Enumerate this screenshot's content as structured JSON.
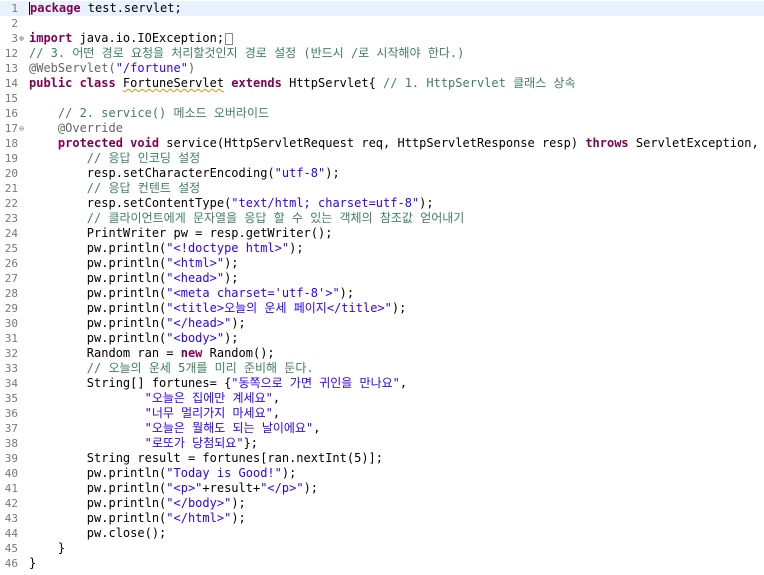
{
  "editor": {
    "language": "java",
    "current_line": 1,
    "fold_icons": {
      "3": "fold-expand-icon",
      "17": "fold-collapse-icon"
    },
    "colors": {
      "keyword": "#7f0055",
      "string": "#2a00ff",
      "comment": "#3f7f5f",
      "annotation": "#646464",
      "line_number": "#787878",
      "current_line_bg": "#e8f2fe"
    }
  },
  "lines": [
    {
      "num": "1",
      "segments": [
        {
          "t": "kw",
          "v": "package"
        },
        {
          "t": "n",
          "v": " test.servlet;"
        }
      ]
    },
    {
      "num": "2",
      "segments": []
    },
    {
      "num": "3",
      "fold": "expand",
      "segments": [
        {
          "t": "kw",
          "v": "import"
        },
        {
          "t": "n",
          "v": " java.io.IOException;"
        }
      ]
    },
    {
      "num": "12",
      "segments": [
        {
          "t": "cm",
          "v": "// 3. 어떤 경로 요청을 처리할것인지 경로 설정 (반드시 /로 시작해야 한다.)"
        }
      ]
    },
    {
      "num": "13",
      "segments": [
        {
          "t": "an",
          "v": "@WebServlet("
        },
        {
          "t": "str",
          "v": "\"/fortune\""
        },
        {
          "t": "an",
          "v": ")"
        }
      ]
    },
    {
      "num": "14",
      "segments": [
        {
          "t": "kw",
          "v": "public class "
        },
        {
          "t": "warn",
          "v": "FortuneServlet"
        },
        {
          "t": "kw",
          "v": " extends "
        },
        {
          "t": "n",
          "v": "HttpServlet{ "
        },
        {
          "t": "cm",
          "v": "// 1. HttpServlet 클래스 상속"
        }
      ]
    },
    {
      "num": "15",
      "segments": []
    },
    {
      "num": "16",
      "segments": [
        {
          "t": "cm",
          "v": "    // 2. service() 메소드 오버라이드"
        }
      ]
    },
    {
      "num": "17",
      "fold": "collapse",
      "segments": [
        {
          "t": "an",
          "v": "    @Override"
        }
      ]
    },
    {
      "num": "18",
      "segments": [
        {
          "t": "kw",
          "v": "    protected void "
        },
        {
          "t": "n",
          "v": "service(HttpServletRequest req, HttpServletResponse resp) "
        },
        {
          "t": "kw",
          "v": "throws "
        },
        {
          "t": "n",
          "v": "ServletException, IOE"
        }
      ]
    },
    {
      "num": "19",
      "segments": [
        {
          "t": "cm",
          "v": "        // 응답 인코딩 설정"
        }
      ]
    },
    {
      "num": "20",
      "segments": [
        {
          "t": "n",
          "v": "        resp.setCharacterEncoding("
        },
        {
          "t": "str",
          "v": "\"utf-8\""
        },
        {
          "t": "n",
          "v": ");"
        }
      ]
    },
    {
      "num": "21",
      "segments": [
        {
          "t": "cm",
          "v": "        // 응답 컨텐트 설정"
        }
      ]
    },
    {
      "num": "22",
      "segments": [
        {
          "t": "n",
          "v": "        resp.setContentType("
        },
        {
          "t": "str",
          "v": "\"text/html; charset=utf-8\""
        },
        {
          "t": "n",
          "v": ");"
        }
      ]
    },
    {
      "num": "23",
      "segments": [
        {
          "t": "cm",
          "v": "        // 클라이언트에게 문자열을 응답 할 수 있는 객체의 참조값 얻어내기"
        }
      ]
    },
    {
      "num": "24",
      "segments": [
        {
          "t": "n",
          "v": "        PrintWriter pw = resp.getWriter();"
        }
      ]
    },
    {
      "num": "25",
      "segments": [
        {
          "t": "n",
          "v": "        pw.println("
        },
        {
          "t": "str",
          "v": "\"<!doctype html>\""
        },
        {
          "t": "n",
          "v": ");"
        }
      ]
    },
    {
      "num": "26",
      "segments": [
        {
          "t": "n",
          "v": "        pw.println("
        },
        {
          "t": "str",
          "v": "\"<html>\""
        },
        {
          "t": "n",
          "v": ");"
        }
      ]
    },
    {
      "num": "27",
      "segments": [
        {
          "t": "n",
          "v": "        pw.println("
        },
        {
          "t": "str",
          "v": "\"<head>\""
        },
        {
          "t": "n",
          "v": ");"
        }
      ]
    },
    {
      "num": "28",
      "segments": [
        {
          "t": "n",
          "v": "        pw.println("
        },
        {
          "t": "str",
          "v": "\"<meta charset='utf-8'>\""
        },
        {
          "t": "n",
          "v": ");"
        }
      ]
    },
    {
      "num": "29",
      "segments": [
        {
          "t": "n",
          "v": "        pw.println("
        },
        {
          "t": "str",
          "v": "\"<title>오늘의 운세 페이지</title>\""
        },
        {
          "t": "n",
          "v": ");"
        }
      ]
    },
    {
      "num": "30",
      "segments": [
        {
          "t": "n",
          "v": "        pw.println("
        },
        {
          "t": "str",
          "v": "\"</head>\""
        },
        {
          "t": "n",
          "v": ");"
        }
      ]
    },
    {
      "num": "31",
      "segments": [
        {
          "t": "n",
          "v": "        pw.println("
        },
        {
          "t": "str",
          "v": "\"<body>\""
        },
        {
          "t": "n",
          "v": ");"
        }
      ]
    },
    {
      "num": "32",
      "segments": [
        {
          "t": "n",
          "v": "        Random ran = "
        },
        {
          "t": "kw",
          "v": "new "
        },
        {
          "t": "n",
          "v": "Random();"
        }
      ]
    },
    {
      "num": "33",
      "segments": [
        {
          "t": "cm",
          "v": "        // 오늘의 운세 5개를 미리 준비해 둔다."
        }
      ]
    },
    {
      "num": "34",
      "segments": [
        {
          "t": "n",
          "v": "        String[] fortunes= {"
        },
        {
          "t": "str",
          "v": "\"동쪽으로 가면 귀인을 만나요\""
        },
        {
          "t": "n",
          "v": ","
        }
      ]
    },
    {
      "num": "35",
      "segments": [
        {
          "t": "str",
          "v": "                \"오늘은 집에만 계세요\""
        },
        {
          "t": "n",
          "v": ","
        }
      ]
    },
    {
      "num": "36",
      "segments": [
        {
          "t": "str",
          "v": "                \"너무 멀리가지 마세요\""
        },
        {
          "t": "n",
          "v": ","
        }
      ]
    },
    {
      "num": "37",
      "segments": [
        {
          "t": "str",
          "v": "                \"오늘은 뭘해도 되는 날이에요\""
        },
        {
          "t": "n",
          "v": ","
        }
      ]
    },
    {
      "num": "38",
      "segments": [
        {
          "t": "str",
          "v": "                \"로또가 당첨되요\""
        },
        {
          "t": "n",
          "v": "};"
        }
      ]
    },
    {
      "num": "39",
      "segments": [
        {
          "t": "n",
          "v": "        String result = fortunes[ran.nextInt(5)];"
        }
      ]
    },
    {
      "num": "40",
      "segments": [
        {
          "t": "n",
          "v": "        pw.println("
        },
        {
          "t": "str",
          "v": "\"Today is Good!\""
        },
        {
          "t": "n",
          "v": ");"
        }
      ]
    },
    {
      "num": "41",
      "segments": [
        {
          "t": "n",
          "v": "        pw.println("
        },
        {
          "t": "str",
          "v": "\"<p>\""
        },
        {
          "t": "n",
          "v": "+result+"
        },
        {
          "t": "str",
          "v": "\"</p>\""
        },
        {
          "t": "n",
          "v": ");"
        }
      ]
    },
    {
      "num": "42",
      "segments": [
        {
          "t": "n",
          "v": "        pw.println("
        },
        {
          "t": "str",
          "v": "\"</body>\""
        },
        {
          "t": "n",
          "v": ");"
        }
      ]
    },
    {
      "num": "43",
      "segments": [
        {
          "t": "n",
          "v": "        pw.println("
        },
        {
          "t": "str",
          "v": "\"</html>\""
        },
        {
          "t": "n",
          "v": ");"
        }
      ]
    },
    {
      "num": "44",
      "segments": [
        {
          "t": "n",
          "v": "        pw.close();"
        }
      ]
    },
    {
      "num": "45",
      "segments": [
        {
          "t": "n",
          "v": "    }"
        }
      ]
    },
    {
      "num": "46",
      "segments": [
        {
          "t": "n",
          "v": "}"
        }
      ]
    }
  ]
}
